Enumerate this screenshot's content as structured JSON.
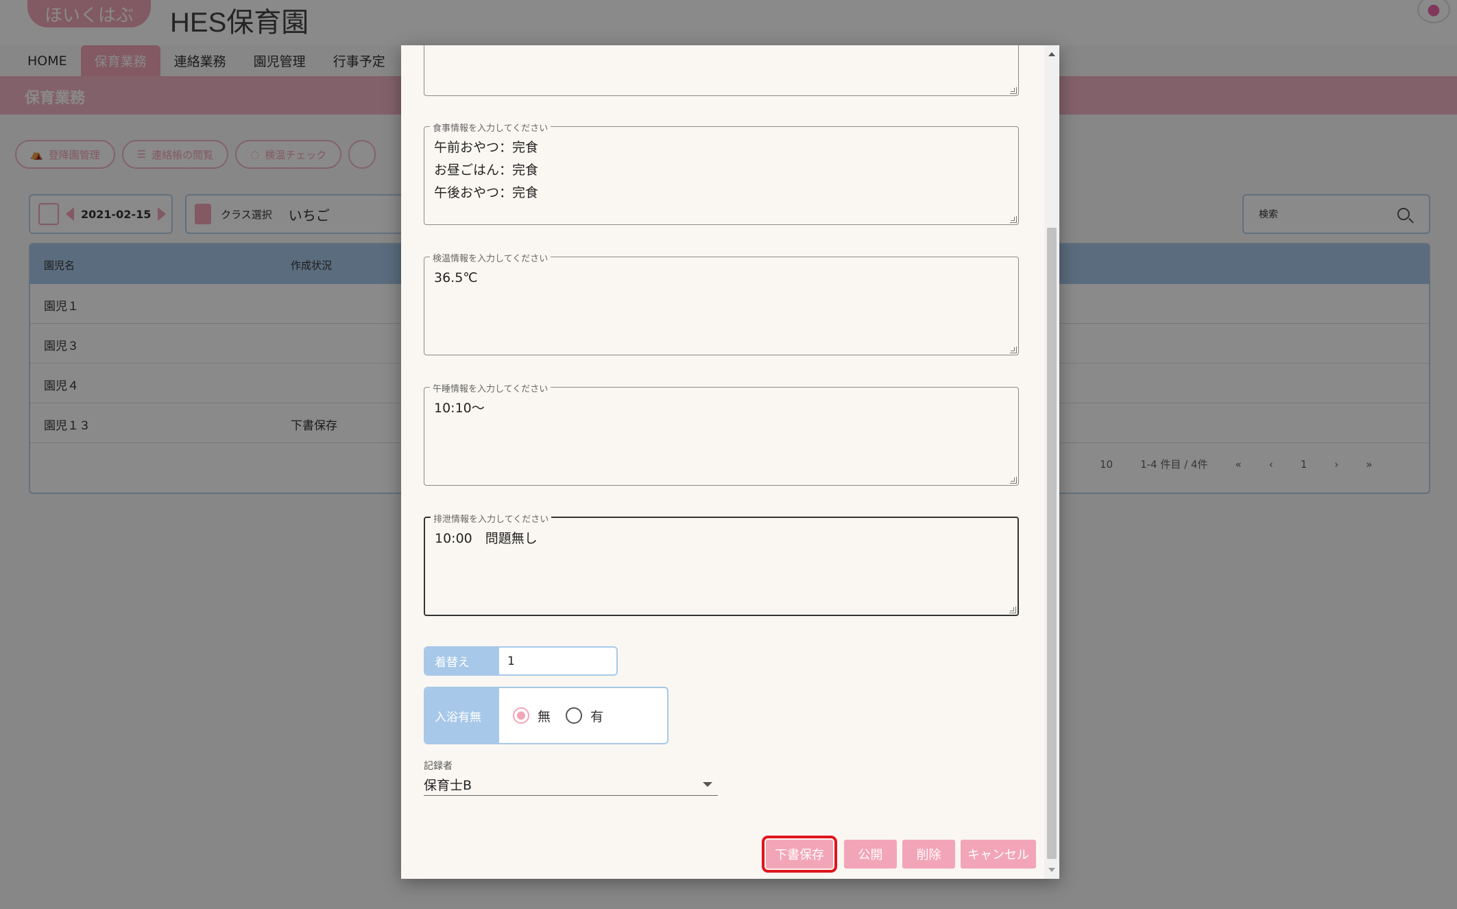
{
  "app": {
    "logo_text": "ほいくはぶ",
    "site_title": "HES保育園",
    "nav_tabs": [
      "HOME",
      "保育業務",
      "連絡業務",
      "園児管理",
      "行事予定"
    ],
    "section_title": "保育業務",
    "pills": [
      "登降園管理",
      "連絡帳の閲覧",
      "検温チェック"
    ],
    "date": "2021-02-15",
    "class_label": "クラス選択",
    "class_value": "いちご",
    "search_placeholder": "検索",
    "table": {
      "headers": [
        "園児名",
        "作成状況"
      ],
      "rows": [
        {
          "name": "園児１",
          "status": ""
        },
        {
          "name": "園児３",
          "status": ""
        },
        {
          "name": "園児４",
          "status": ""
        },
        {
          "name": "園児１３",
          "status": "下書保存"
        }
      ],
      "per_page": "10",
      "range": "1-4 件目 / 4件",
      "page": "1"
    }
  },
  "dialog": {
    "meal": {
      "legend": "食事情報を入力してください",
      "text": "午前おやつ：完食\nお昼ごはん：完食\n午後おやつ：完食"
    },
    "temperature": {
      "legend": "検温情報を入力してください",
      "text": "36.5℃"
    },
    "nap": {
      "legend": "午睡情報を入力してください",
      "text": "10:10～"
    },
    "excretion": {
      "legend": "排泄情報を入力してください",
      "text": "10:00　問題無し"
    },
    "change_clothes": {
      "label": "着替え",
      "value": "1"
    },
    "bath": {
      "label": "入浴有無",
      "options": [
        "無",
        "有"
      ],
      "selected": "無"
    },
    "recorder": {
      "caption": "記録者",
      "value": "保育士B"
    },
    "buttons": {
      "draft": "下書保存",
      "publish": "公開",
      "delete": "削除",
      "cancel": "キャンセル"
    }
  }
}
